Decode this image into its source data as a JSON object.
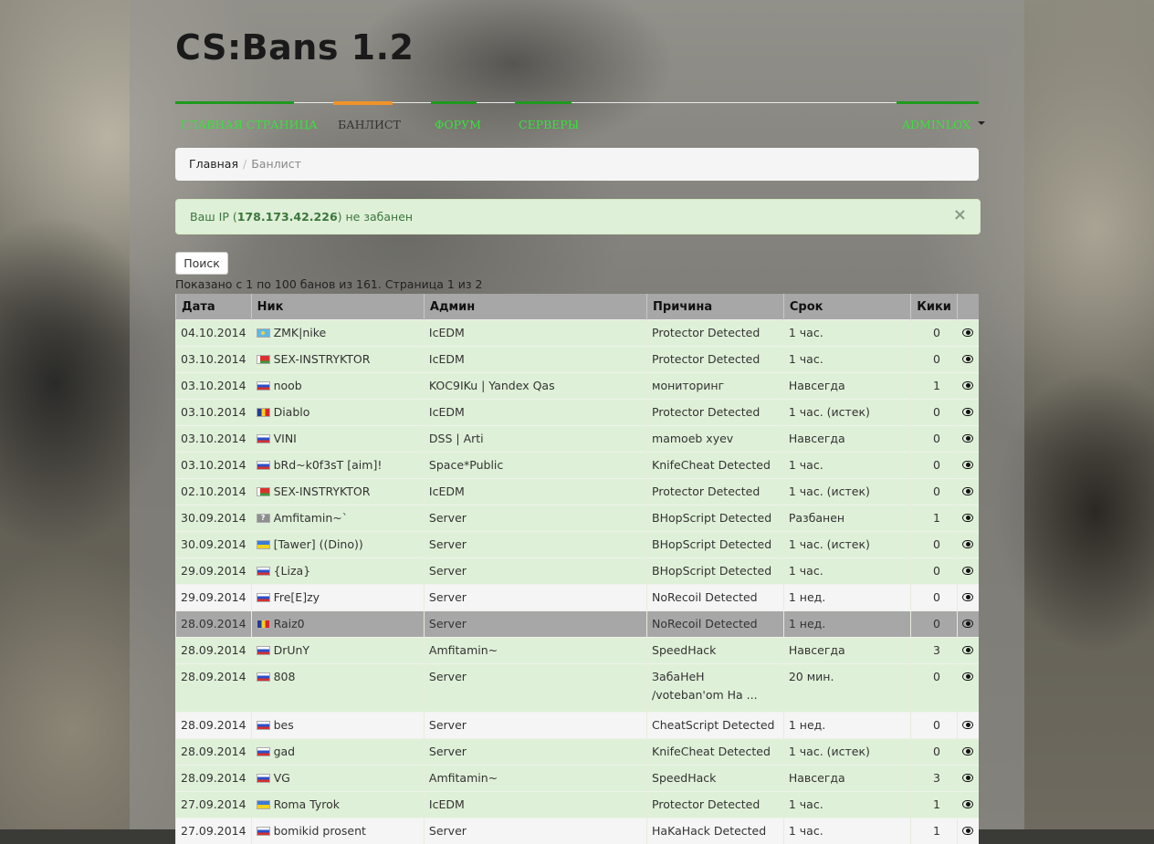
{
  "site": {
    "brand": "CS:Bans 1.2"
  },
  "nav": {
    "items": [
      {
        "label": "Главная страница",
        "active": false
      },
      {
        "label": "Банлист",
        "active": true
      },
      {
        "label": "Форум",
        "active": false
      },
      {
        "label": "Серверы",
        "active": false
      }
    ],
    "user": "adminlox"
  },
  "breadcrumb": {
    "home": "Главная",
    "separator": "/",
    "current": "Банлист"
  },
  "alert": {
    "prefix": "Ваш IP (",
    "ip": "178.173.42.226",
    "suffix": ") не забанен",
    "close": "×"
  },
  "search": {
    "label": "Поиск"
  },
  "summary": "Показано с 1 по 100 банов из 161. Страница 1 из 2",
  "table": {
    "headers": [
      "Дата",
      "Ник",
      "Админ",
      "Причина",
      "Срок",
      "Кики"
    ],
    "rows": [
      {
        "date": "04.10.2014",
        "flag": "kz",
        "nick": "ZMK|nike",
        "admin": "IcEDM",
        "reason": "Protector Detected",
        "term": "1 час.",
        "kicks": "0",
        "style": "green"
      },
      {
        "date": "03.10.2014",
        "flag": "by",
        "nick": "SEX-INSTRYKTOR",
        "admin": "IcEDM",
        "reason": "Protector Detected",
        "term": "1 час.",
        "kicks": "0",
        "style": "green"
      },
      {
        "date": "03.10.2014",
        "flag": "ru",
        "nick": "noob",
        "admin": "KOC9IKu | Yandex Qas",
        "reason": "мониторинг",
        "term": "Навсегда",
        "kicks": "1",
        "style": "green"
      },
      {
        "date": "03.10.2014",
        "flag": "ro",
        "nick": "Diablo",
        "admin": "IcEDM",
        "reason": "Protector Detected",
        "term": "1 час. (истек)",
        "kicks": "0",
        "style": "green"
      },
      {
        "date": "03.10.2014",
        "flag": "ru",
        "nick": "VINI",
        "admin": "DSS | Arti",
        "reason": "mamoeb xyev",
        "term": "Навсегда",
        "kicks": "0",
        "style": "green"
      },
      {
        "date": "03.10.2014",
        "flag": "ru",
        "nick": "bRd~k0f3sT [aim]!",
        "admin": "Space*Public",
        "reason": "KnifeCheat Detected",
        "term": "1 час.",
        "kicks": "0",
        "style": "green"
      },
      {
        "date": "02.10.2014",
        "flag": "by",
        "nick": "SEX-INSTRYKTOR",
        "admin": "IcEDM",
        "reason": "Protector Detected",
        "term": "1 час. (истек)",
        "kicks": "0",
        "style": "green"
      },
      {
        "date": "30.09.2014",
        "flag": "unk",
        "nick": "Amfitamin~`",
        "admin": "Server",
        "reason": "BHopScript Detected",
        "term": "Разбанен",
        "kicks": "1",
        "style": "green"
      },
      {
        "date": "30.09.2014",
        "flag": "ua",
        "nick": "[Tawer] ((Dino))",
        "admin": "Server",
        "reason": "BHopScript Detected",
        "term": "1 час. (истек)",
        "kicks": "0",
        "style": "green"
      },
      {
        "date": "29.09.2014",
        "flag": "ru",
        "nick": "{Liza}",
        "admin": "Server",
        "reason": "BHopScript Detected",
        "term": "1 час.",
        "kicks": "0",
        "style": "green"
      },
      {
        "date": "29.09.2014",
        "flag": "ru",
        "nick": "Fre[E]zy",
        "admin": "Server",
        "reason": "NoRecoil Detected",
        "term": "1 нед.",
        "kicks": "0",
        "style": "white"
      },
      {
        "date": "28.09.2014",
        "flag": "ro",
        "nick": "Raiz0",
        "admin": "Server",
        "reason": "NoRecoil Detected",
        "term": "1 нед.",
        "kicks": "0",
        "style": "grey"
      },
      {
        "date": "28.09.2014",
        "flag": "ru",
        "nick": "DrUnY",
        "admin": "Amfitamin~",
        "reason": "SpeedHack",
        "term": "Навсегда",
        "kicks": "3",
        "style": "green"
      },
      {
        "date": "28.09.2014",
        "flag": "ru",
        "nick": "808",
        "admin": "Server",
        "reason": "ЗабаНеН /voteban'om На ...",
        "term": "20 мин.",
        "kicks": "0",
        "style": "green tall"
      },
      {
        "date": "28.09.2014",
        "flag": "ru",
        "nick": "bes",
        "admin": "Server",
        "reason": "CheatScript Detected",
        "term": "1 нед.",
        "kicks": "0",
        "style": "white"
      },
      {
        "date": "28.09.2014",
        "flag": "ru",
        "nick": "gad",
        "admin": "Server",
        "reason": "KnifeCheat Detected",
        "term": "1 час. (истек)",
        "kicks": "0",
        "style": "green"
      },
      {
        "date": "28.09.2014",
        "flag": "ru",
        "nick": "VG",
        "admin": "Amfitamin~",
        "reason": "SpeedHack",
        "term": "Навсегда",
        "kicks": "3",
        "style": "green"
      },
      {
        "date": "27.09.2014",
        "flag": "ua",
        "nick": "Roma Tyrok",
        "admin": "IcEDM",
        "reason": "Protector Detected",
        "term": "1 час.",
        "kicks": "1",
        "style": "green"
      },
      {
        "date": "27.09.2014",
        "flag": "ru",
        "nick": "bomikid prosent",
        "admin": "Server",
        "reason": "HaKaHack Detected",
        "term": "1 час.",
        "kicks": "1",
        "style": "white"
      }
    ]
  }
}
